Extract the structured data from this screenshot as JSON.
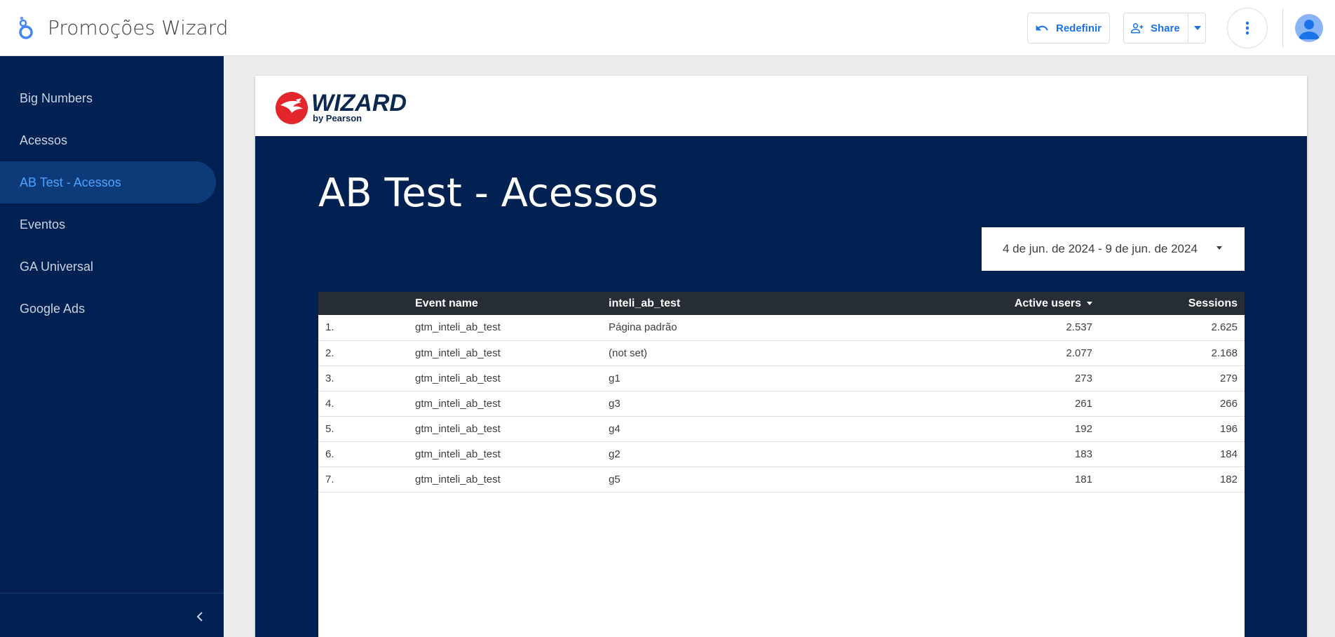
{
  "app": {
    "title": "Promoções Wizard"
  },
  "toolbar": {
    "reset_label": "Redefinir",
    "share_label": "Share"
  },
  "sidebar": {
    "items": [
      {
        "label": "Big Numbers",
        "active": false
      },
      {
        "label": "Acessos",
        "active": false
      },
      {
        "label": "AB Test - Acessos",
        "active": true
      },
      {
        "label": "Eventos",
        "active": false
      },
      {
        "label": "GA Universal",
        "active": false
      },
      {
        "label": "Google Ads",
        "active": false
      }
    ]
  },
  "report": {
    "brand": {
      "name": "WIZARD",
      "sub": "by Pearson"
    },
    "title": "AB Test - Acessos",
    "date_range": "4 de jun. de 2024 - 9 de jun. de 2024",
    "table": {
      "columns": [
        "",
        "Event name",
        "inteli_ab_test",
        "Active users",
        "Sessions"
      ],
      "sorted_column": "Active users",
      "sort_direction": "desc",
      "rows": [
        {
          "idx": "1.",
          "event": "gtm_inteli_ab_test",
          "variant": "Página padrão",
          "users": "2.537",
          "sessions": "2.625"
        },
        {
          "idx": "2.",
          "event": "gtm_inteli_ab_test",
          "variant": "(not set)",
          "users": "2.077",
          "sessions": "2.168"
        },
        {
          "idx": "3.",
          "event": "gtm_inteli_ab_test",
          "variant": "g1",
          "users": "273",
          "sessions": "279"
        },
        {
          "idx": "4.",
          "event": "gtm_inteli_ab_test",
          "variant": "g3",
          "users": "261",
          "sessions": "266"
        },
        {
          "idx": "5.",
          "event": "gtm_inteli_ab_test",
          "variant": "g4",
          "users": "192",
          "sessions": "196"
        },
        {
          "idx": "6.",
          "event": "gtm_inteli_ab_test",
          "variant": "g2",
          "users": "183",
          "sessions": "184"
        },
        {
          "idx": "7.",
          "event": "gtm_inteli_ab_test",
          "variant": "g5",
          "users": "181",
          "sessions": "182"
        }
      ]
    }
  },
  "icons": {
    "app_logo": "looker-studio-icon",
    "reset": "undo-icon",
    "share": "person-add-icon",
    "more": "more-vert-icon",
    "avatar": "account-avatar-icon",
    "collapse": "chevron-left-icon"
  },
  "colors": {
    "accent": "#1a73e8",
    "sidebar_bg": "#002152",
    "sidebar_active": "#0d3b7a",
    "sidebar_active_text": "#4da3ff",
    "table_header_bg": "#262d34",
    "brand_red": "#e3262b"
  }
}
